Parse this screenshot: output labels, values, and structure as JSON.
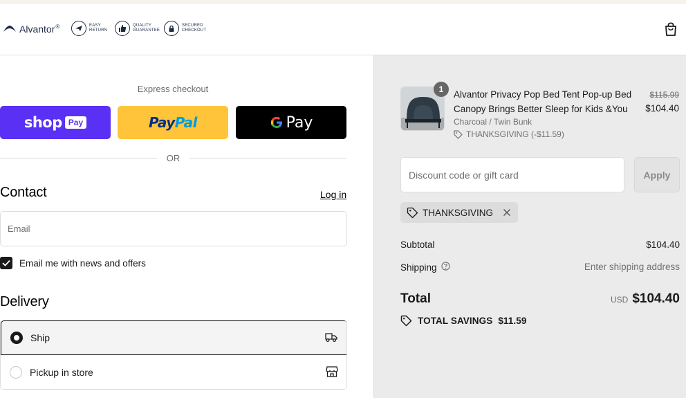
{
  "header": {
    "brand": "Alvantor",
    "brand_mark": "®",
    "badges": [
      {
        "icon": "plane-icon",
        "line1": "EASY",
        "line2": "RETURN"
      },
      {
        "icon": "thumbs-up-icon",
        "line1": "QUALITY",
        "line2": "GUARANTEE"
      },
      {
        "icon": "lock-icon",
        "line1": "SECURED",
        "line2": "CHECKOUT"
      }
    ],
    "cart_icon": "shopping-bag-icon"
  },
  "express": {
    "title": "Express checkout",
    "shop_label": "shop",
    "shop_pill": "Pay",
    "paypal_part1": "Pay",
    "paypal_part2": "Pal",
    "gpay_label": "Pay",
    "or_label": "OR"
  },
  "contact": {
    "heading": "Contact",
    "login_label": "Log in",
    "email_placeholder": "Email",
    "newsletter_label": "Email me with news and offers",
    "newsletter_checked": true
  },
  "delivery": {
    "heading": "Delivery",
    "options": [
      {
        "label": "Ship",
        "selected": true,
        "icon": "truck-icon"
      },
      {
        "label": "Pickup in store",
        "selected": false,
        "icon": "store-icon"
      }
    ]
  },
  "order": {
    "item": {
      "quantity": "1",
      "name": "Alvantor Privacy Pop Bed Tent Pop-up Bed Canopy Brings Better Sleep for Kids &You",
      "variant": "Charcoal / Twin Bunk",
      "discount": "THANKSGIVING (-$11.59)",
      "price_original": "$115.99",
      "price_final": "$104.40"
    },
    "discount_placeholder": "Discount code or gift card",
    "apply_label": "Apply",
    "applied_code": "THANKSGIVING",
    "subtotal_label": "Subtotal",
    "subtotal_value": "$104.40",
    "shipping_label": "Shipping",
    "shipping_value": "Enter shipping address",
    "total_label": "Total",
    "currency": "USD",
    "total_value": "$104.40",
    "savings_label": "TOTAL SAVINGS",
    "savings_value": "$11.59"
  },
  "colors": {
    "shop_pay": "#5a31f4",
    "paypal": "#ffc439",
    "gpay": "#000000",
    "summary_bg": "#ebebeb"
  }
}
